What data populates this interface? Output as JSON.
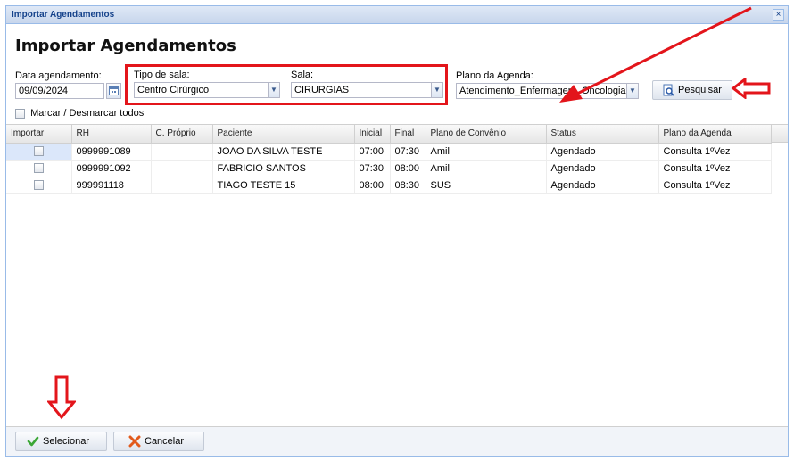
{
  "window": {
    "title": "Importar Agendamentos",
    "close_glyph": "×"
  },
  "heading": "Importar Agendamentos",
  "filters": {
    "data_label": "Data agendamento:",
    "data_value": "09/09/2024",
    "tipo_label": "Tipo de sala:",
    "tipo_value": "Centro Cirúrgico",
    "sala_label": "Sala:",
    "sala_value": "CIRURGIAS",
    "plano_label": "Plano da Agenda:",
    "plano_value": "Atendimento_Enfermagem_Oncologia"
  },
  "pesquisar_label": "Pesquisar",
  "marcar_label": "Marcar / Desmarcar todos",
  "grid": {
    "columns": [
      "Importar",
      "RH",
      "C. Próprio",
      "Paciente",
      "Inicial",
      "Final",
      "Plano de Convênio",
      "Status",
      "Plano da Agenda"
    ],
    "rows": [
      {
        "rh": "0999991089",
        "proprio": "",
        "paciente": "JOAO DA SILVA TESTE",
        "inicial": "07:00",
        "final": "07:30",
        "convenio": "Amil",
        "status": "Agendado",
        "plano": "Consulta 1ºVez"
      },
      {
        "rh": "0999991092",
        "proprio": "",
        "paciente": "FABRICIO SANTOS",
        "inicial": "07:30",
        "final": "08:00",
        "convenio": "Amil",
        "status": "Agendado",
        "plano": "Consulta 1ºVez"
      },
      {
        "rh": "999991118",
        "proprio": "",
        "paciente": "TIAGO TESTE 15",
        "inicial": "08:00",
        "final": "08:30",
        "convenio": "SUS",
        "status": "Agendado",
        "plano": "Consulta 1ºVez"
      }
    ]
  },
  "footer": {
    "selecionar_label": "Selecionar",
    "cancelar_label": "Cancelar"
  },
  "icons": {
    "calendar": "calendar-icon",
    "dropdown": "chevron-down-icon",
    "search": "search-icon",
    "check": "check-icon",
    "cancel": "cancel-icon",
    "annotation_arrow": "red-arrow-icon"
  },
  "colors": {
    "annotation": "#e3151b",
    "title_text": "#15428b",
    "selected_row": "#dbe7fa"
  }
}
